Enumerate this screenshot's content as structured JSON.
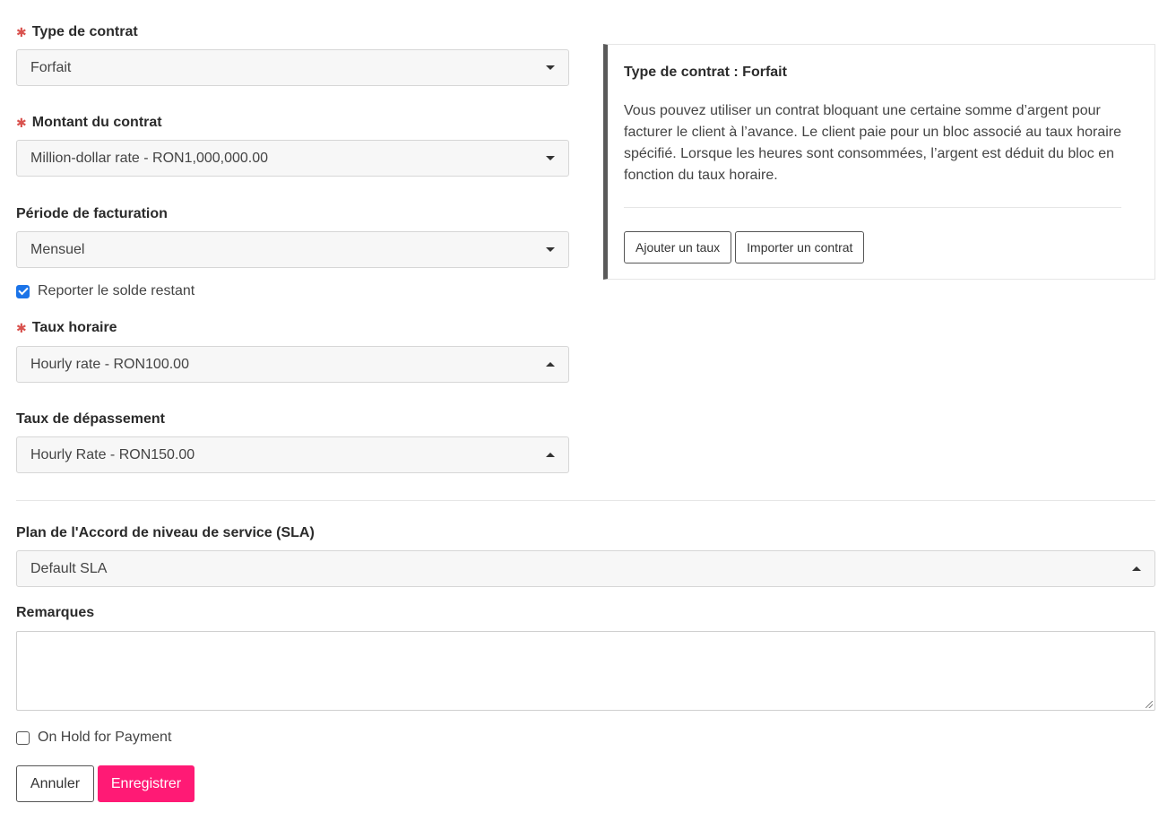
{
  "form": {
    "contract_type": {
      "label": "Type de contrat",
      "required": true,
      "value": "Forfait",
      "caret": "down"
    },
    "contract_amount": {
      "label": "Montant du contrat",
      "required": true,
      "value": "Million-dollar rate - RON1,000,000.00",
      "caret": "down"
    },
    "billing_period": {
      "label": "Période de facturation",
      "required": false,
      "value": "Mensuel",
      "caret": "down"
    },
    "rollover": {
      "label": "Reporter le solde restant",
      "checked": true
    },
    "hourly_rate": {
      "label": "Taux horaire",
      "required": true,
      "value": "Hourly rate - RON100.00",
      "caret": "up"
    },
    "overage_rate": {
      "label": "Taux de dépassement",
      "required": false,
      "value": "Hourly Rate - RON150.00",
      "caret": "up"
    },
    "sla_plan": {
      "label": "Plan de l'Accord de niveau de service (SLA)",
      "value": "Default SLA",
      "caret": "up"
    },
    "remarks": {
      "label": "Remarques",
      "value": ""
    },
    "on_hold": {
      "label": "On Hold for Payment",
      "checked": false
    },
    "required_mark": "✱"
  },
  "info_card": {
    "title": "Type de contrat : Forfait",
    "description": "Vous pouvez utiliser un contrat bloquant une certaine somme d’argent pour facturer le client à l’avance. Le client paie pour un bloc associé au taux horaire spécifié. Lorsque les heures sont consommées, l’argent est déduit du bloc en fonction du taux horaire.",
    "add_rate_label": "Ajouter un taux",
    "import_contract_label": "Importer un contrat"
  },
  "actions": {
    "cancel_label": "Annuler",
    "save_label": "Enregistrer"
  },
  "colors": {
    "primary": "#ff1a75",
    "required": "#d9534f",
    "checkbox": "#1a73e8"
  }
}
